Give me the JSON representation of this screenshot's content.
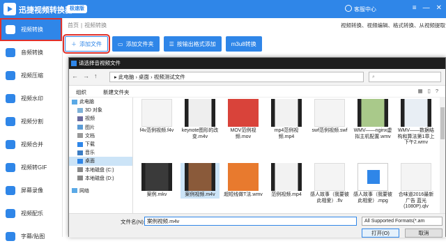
{
  "app": {
    "title": "迅捷视频转换器",
    "edition": "极速版",
    "support": "客服中心"
  },
  "sidebar": {
    "items": [
      "视频转换",
      "音频转换",
      "视频压缩",
      "视频水印",
      "视频分割",
      "视频合并",
      "视频转GIF",
      "屏幕录像",
      "视频配乐",
      "字幕/贴图"
    ]
  },
  "breadcrumb": {
    "home": "首页",
    "current": "视频转换"
  },
  "right_note": "视频转换、视频编辑、格式转换、从视频提取音频",
  "toolbar": {
    "add_file": "添加文件",
    "add_folder": "添加文件夹",
    "batch_add": "按输出格式添加",
    "m3u8": "m3u8转换"
  },
  "dialog": {
    "title": "请选择音视频文件",
    "path": [
      "此电脑",
      "桌面",
      "视频测试文件"
    ],
    "organize": "组织",
    "new_folder": "新建文件夹",
    "tree": [
      "此电脑",
      "3D 对象",
      "视频",
      "图片",
      "文档",
      "下载",
      "音乐",
      "桌面",
      "本地磁盘 (C:)",
      "本地磁盘 (D:)",
      "网络"
    ],
    "files": [
      "f4v范例视频.f4v",
      "keynote图形的改变.m4v",
      "MOV范例视频.mov",
      "mp4范例视频.mp4",
      "swf范例视频.swf",
      "WMV——nginx虚拟主机配置.wmv",
      "WMV——数据结构和算法第1章上下午2.wmv",
      "案例.mkv",
      "案例视频.m4v",
      "超短线做T法.wmv",
      "范例视频.mp4",
      "感人故事（我要彼此相爱）.flv",
      "感人故事（我要彼此相爱）.mpg",
      "合味道2016最新广告 蓝光(1080P).qlv"
    ],
    "filename_label": "文件名(N):",
    "filename": "案例视频.m4v",
    "filetype": "All Supported Formats(*.am",
    "open": "打开(O)",
    "cancel": "取消"
  }
}
